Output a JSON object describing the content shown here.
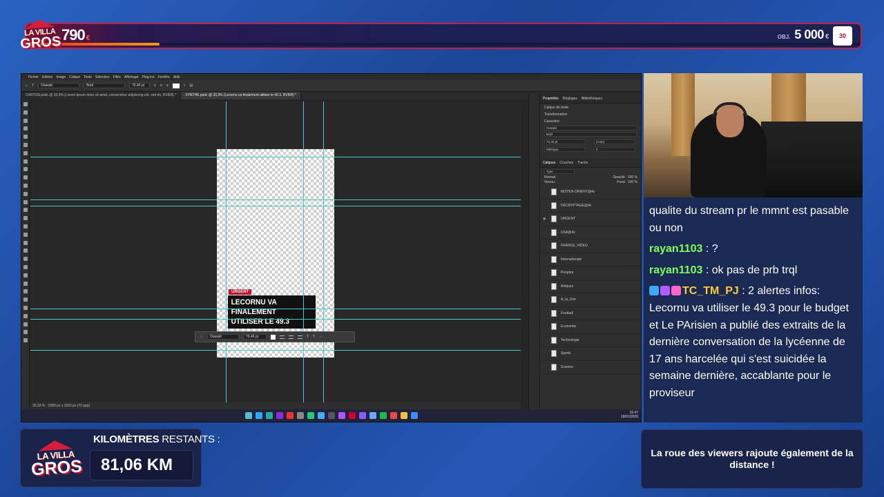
{
  "overlay": {
    "logo": {
      "line1": "LA VILLA",
      "line2": "GROS",
      "small": "DES"
    },
    "counter": {
      "value": "790",
      "currency": "€"
    },
    "progress_fraction": 0.16,
    "goal": {
      "prefix": "OBJ.",
      "value": "5 000",
      "currency": "€"
    },
    "badge": "30"
  },
  "photoshop": {
    "menu": [
      "Fichier",
      "Edition",
      "Image",
      "Calque",
      "Texte",
      "Sélection",
      "Filtre",
      "Affichage",
      "Plug-ins",
      "Fenêtre",
      "Aide"
    ],
    "options": {
      "font": "Oswald",
      "style": "Bold",
      "size": "76,46 pt"
    },
    "tabs": [
      {
        "label": "CARTON.psdc @ 33,3% (Lorem ipsum dolor sit amet, consectetur adipiscing elit, sed do, RVB/8) *"
      },
      {
        "label": "SYNTHE.psdc @ 33,3% (Lecornu va finalement utiliser le 49.3, RVB/8) *"
      }
    ],
    "doc": {
      "tag": "URGENT",
      "headline_line1": "LECORNU VA FINALEMENT",
      "headline_line2": "UTILISER LE 49.3"
    },
    "context_bar": {
      "font": "Oswald",
      "size": "76,46 pt"
    },
    "status": {
      "zoom": "33,33 %",
      "size": "1080 px x 1920 px (72 ppp)"
    },
    "panels": {
      "tabs": [
        "Propriétés",
        "Réglages",
        "Bibliothèques"
      ],
      "layer_label": "Calque de texte",
      "transform": "Transformation",
      "character": "Caractère",
      "font": "Oswald",
      "style": "Bold",
      "size": "76,46 pt",
      "leading": "(Auto)",
      "kerning": "Métrique",
      "tracking": "0",
      "layer_tabs": [
        "Calques",
        "Couches",
        "Tracés"
      ],
      "blend": "Normal",
      "opacity_label": "Opacité :",
      "opacity": "100 %",
      "fill_label": "Fond :",
      "fill": "100 %",
      "lock_label": "Verrou :",
      "type_filter": "Type",
      "layers": [
        "MOYEN-ORIENT@4x",
        "DÉCRYPTAGE@4x",
        "URGENT",
        "USA@4x",
        "FRANCE_VIDEO",
        "Internationale",
        "Peoples",
        "Afriques",
        "A_la_Une",
        "Football",
        "Economie",
        "Technologie",
        "Sports",
        "Science"
      ]
    },
    "clock": {
      "time": "15:47",
      "date": "18/01/2026"
    }
  },
  "chat": {
    "messages": [
      {
        "user": "",
        "text": "qualite du stream pr le mmnt est pasable ou non"
      },
      {
        "user": "rayan1103",
        "text": "?"
      },
      {
        "user": "rayan1103",
        "text": "ok pas de prb trql"
      },
      {
        "user": "TC_TM_PJ",
        "text": "2 alertes infos: Lecornu va utiliser le 49.3 pour le budget et Le PArisien a publié des extraits de la dernière conversation de la lycéenne de 17 ans harcelée qui s'est suicidée la semaine dernière, accablante pour le proviseur"
      }
    ]
  },
  "bottom": {
    "km_label_bold": "KILOMÈTRES",
    "km_label_rest": "RESTANTS :",
    "km_value": "81,06 KM",
    "info_text": "La roue des viewers rajoute également de la distance !"
  },
  "colors": {
    "accent": "#c8102e",
    "chat_user": "#7fff5a",
    "chat_user_alt": "#ffce2e",
    "guide": "#4ec9c9"
  }
}
